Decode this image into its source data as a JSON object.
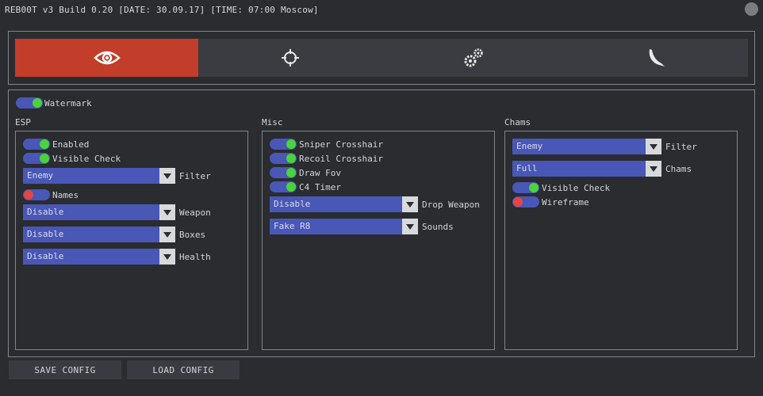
{
  "window": {
    "title": "REB00T v3 Build 0.20 [DATE: 30.09.17] [TIME: 07:00 Moscow]"
  },
  "tabs": [
    {
      "icon": "eye-icon",
      "active": true
    },
    {
      "icon": "crosshair-icon",
      "active": false
    },
    {
      "icon": "gears-icon",
      "active": false
    },
    {
      "icon": "knife-icon",
      "active": false
    }
  ],
  "colors": {
    "accent": "#c23e2b",
    "toggle_track": "#4957b6",
    "on": "#48d43a",
    "off": "#e54545"
  },
  "watermark": {
    "label": "Watermark",
    "state": "on"
  },
  "esp": {
    "title": "ESP",
    "enabled": {
      "label": "Enabled",
      "state": "on"
    },
    "visible_check": {
      "label": "Visible Check",
      "state": "on"
    },
    "filter": {
      "value": "Enemy",
      "label": "Filter"
    },
    "names": {
      "label": "Names",
      "state": "off"
    },
    "weapon": {
      "value": "Disable",
      "label": "Weapon"
    },
    "boxes": {
      "value": "Disable",
      "label": "Boxes"
    },
    "health": {
      "value": "Disable",
      "label": "Health"
    }
  },
  "misc": {
    "title": "Misc",
    "sniper_crosshair": {
      "label": "Sniper Crosshair",
      "state": "on"
    },
    "recoil_crosshair": {
      "label": "Recoil Crosshair",
      "state": "on"
    },
    "draw_fov": {
      "label": "Draw Fov",
      "state": "on"
    },
    "c4_timer": {
      "label": "C4 Timer",
      "state": "on"
    },
    "drop_weapon": {
      "value": "Disable",
      "label": "Drop Weapon"
    },
    "sounds": {
      "value": "Fake R8",
      "label": "Sounds"
    }
  },
  "chams": {
    "title": "Chams",
    "filter": {
      "value": "Enemy",
      "label": "Filter"
    },
    "chams": {
      "value": "Full",
      "label": "Chams"
    },
    "visible_check": {
      "label": "Visible Check",
      "state": "on"
    },
    "wireframe": {
      "label": "Wireframe",
      "state": "off"
    }
  },
  "footer": {
    "save_label": "SAVE CONFIG",
    "load_label": "LOAD CONFIG"
  }
}
